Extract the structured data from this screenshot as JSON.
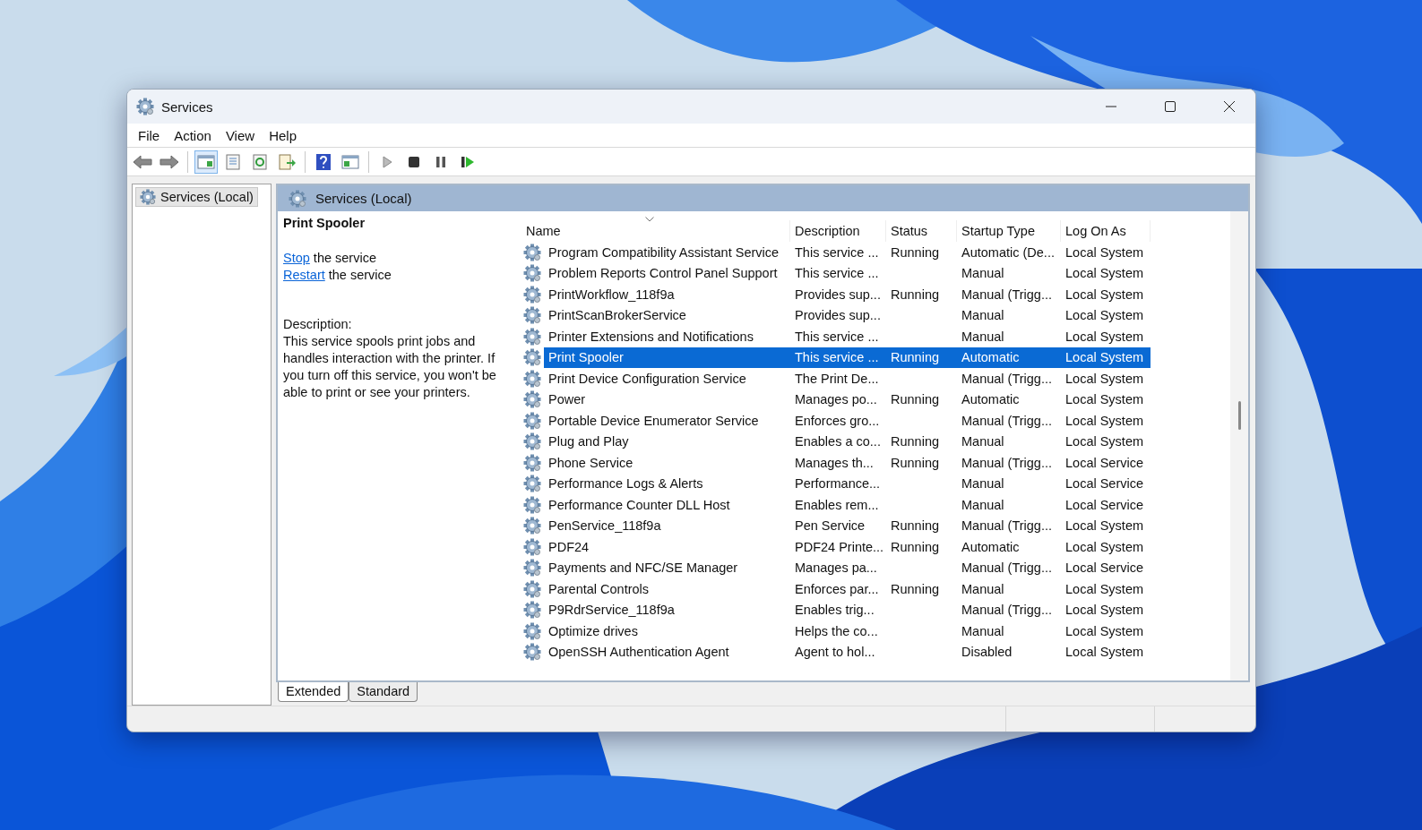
{
  "window": {
    "title": "Services"
  },
  "menu": [
    "File",
    "Action",
    "View",
    "Help"
  ],
  "tree": [
    {
      "label": "Services (Local)",
      "selected": true
    }
  ],
  "header": "Services (Local)",
  "detail": {
    "title": "Print Spooler",
    "actions": [
      {
        "link": "Stop",
        "text": " the service"
      },
      {
        "link": "Restart",
        "text": " the service"
      }
    ],
    "description_label": "Description:",
    "description": "This service spools print jobs and handles interaction with the printer. If you turn off this service, you won't be able to print or see your printers."
  },
  "table": {
    "columns": [
      "Name",
      "Description",
      "Status",
      "Startup Type",
      "Log On As"
    ],
    "rows": [
      {
        "name": "Program Compatibility Assistant Service",
        "description": "This service ...",
        "status": "Running",
        "startup_type": "Automatic (De...",
        "log_on_as": "Local System",
        "selected": false
      },
      {
        "name": "Problem Reports Control Panel Support",
        "description": "This service ...",
        "status": "",
        "startup_type": "Manual",
        "log_on_as": "Local System",
        "selected": false
      },
      {
        "name": "PrintWorkflow_118f9a",
        "description": "Provides sup...",
        "status": "Running",
        "startup_type": "Manual (Trigg...",
        "log_on_as": "Local System",
        "selected": false
      },
      {
        "name": "PrintScanBrokerService",
        "description": "Provides sup...",
        "status": "",
        "startup_type": "Manual",
        "log_on_as": "Local System",
        "selected": false
      },
      {
        "name": "Printer Extensions and Notifications",
        "description": "This service ...",
        "status": "",
        "startup_type": "Manual",
        "log_on_as": "Local System",
        "selected": false
      },
      {
        "name": "Print Spooler",
        "description": "This service ...",
        "status": "Running",
        "startup_type": "Automatic",
        "log_on_as": "Local System",
        "selected": true
      },
      {
        "name": "Print Device Configuration Service",
        "description": "The Print De...",
        "status": "",
        "startup_type": "Manual (Trigg...",
        "log_on_as": "Local System",
        "selected": false
      },
      {
        "name": "Power",
        "description": "Manages po...",
        "status": "Running",
        "startup_type": "Automatic",
        "log_on_as": "Local System",
        "selected": false
      },
      {
        "name": "Portable Device Enumerator Service",
        "description": "Enforces gro...",
        "status": "",
        "startup_type": "Manual (Trigg...",
        "log_on_as": "Local System",
        "selected": false
      },
      {
        "name": "Plug and Play",
        "description": "Enables a co...",
        "status": "Running",
        "startup_type": "Manual",
        "log_on_as": "Local System",
        "selected": false
      },
      {
        "name": "Phone Service",
        "description": "Manages th...",
        "status": "Running",
        "startup_type": "Manual (Trigg...",
        "log_on_as": "Local Service",
        "selected": false
      },
      {
        "name": "Performance Logs & Alerts",
        "description": "Performance...",
        "status": "",
        "startup_type": "Manual",
        "log_on_as": "Local Service",
        "selected": false
      },
      {
        "name": "Performance Counter DLL Host",
        "description": "Enables rem...",
        "status": "",
        "startup_type": "Manual",
        "log_on_as": "Local Service",
        "selected": false
      },
      {
        "name": "PenService_118f9a",
        "description": "Pen Service",
        "status": "Running",
        "startup_type": "Manual (Trigg...",
        "log_on_as": "Local System",
        "selected": false
      },
      {
        "name": "PDF24",
        "description": "PDF24 Printe...",
        "status": "Running",
        "startup_type": "Automatic",
        "log_on_as": "Local System",
        "selected": false
      },
      {
        "name": "Payments and NFC/SE Manager",
        "description": "Manages pa...",
        "status": "",
        "startup_type": "Manual (Trigg...",
        "log_on_as": "Local Service",
        "selected": false
      },
      {
        "name": "Parental Controls",
        "description": "Enforces par...",
        "status": "Running",
        "startup_type": "Manual",
        "log_on_as": "Local System",
        "selected": false
      },
      {
        "name": "P9RdrService_118f9a",
        "description": "Enables trig...",
        "status": "",
        "startup_type": "Manual (Trigg...",
        "log_on_as": "Local System",
        "selected": false
      },
      {
        "name": "Optimize drives",
        "description": "Helps the co...",
        "status": "",
        "startup_type": "Manual",
        "log_on_as": "Local System",
        "selected": false
      },
      {
        "name": "OpenSSH Authentication Agent",
        "description": "Agent to hol...",
        "status": "",
        "startup_type": "Disabled",
        "log_on_as": "Local System",
        "selected": false
      }
    ]
  },
  "view_tabs": [
    {
      "label": "Extended",
      "selected": true
    },
    {
      "label": "Standard",
      "selected": false
    }
  ]
}
